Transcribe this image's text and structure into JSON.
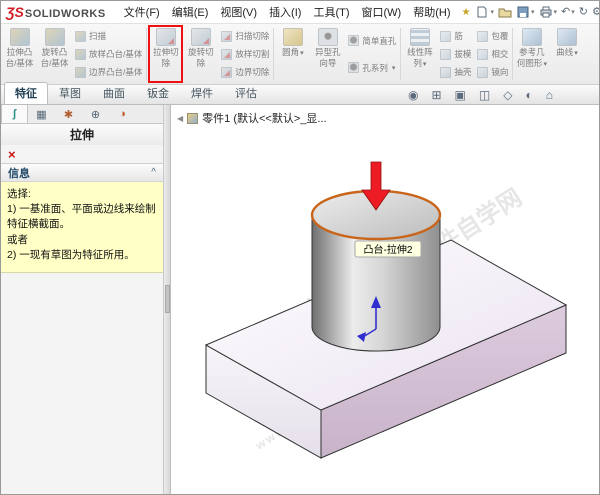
{
  "titlebar": {
    "logo_prefix": "ƷS",
    "logo": "SOLIDWORKS",
    "menus": [
      "文件(F)",
      "编辑(E)",
      "视图(V)",
      "插入(I)",
      "工具(T)",
      "窗口(W)",
      "帮助(H)"
    ]
  },
  "ribbon": {
    "extruded_boss_1": "拉伸凸",
    "extruded_boss_2": "台/基体",
    "revolved_boss_1": "旋转凸",
    "revolved_boss_2": "台/基体",
    "swept_boss": "扫描",
    "lofted_boss": "放样凸台/基体",
    "boundary_boss": "边界凸台/基体",
    "extruded_cut_1": "拉伸切",
    "extruded_cut_2": "除",
    "revolved_cut_1": "旋转切",
    "revolved_cut_2": "除",
    "swept_cut": "扫描切除",
    "lofted_cut": "放样切割",
    "boundary_cut": "边界切除",
    "fillet": "圆角",
    "hole_wizard_1": "异型孔",
    "hole_wizard_2": "向导",
    "simple_hole": "简单直孔",
    "hole_series": "孔系列",
    "linear_pattern_1": "线性阵",
    "linear_pattern_2": "列",
    "rib": "筋",
    "draft": "拔模",
    "shell": "抽壳",
    "wrap": "包覆",
    "intersect": "相交",
    "mirror": "镜向",
    "ref_geo_1": "参考几",
    "ref_geo_2": "何图形",
    "curves": "曲线"
  },
  "tabs": {
    "t0": "特征",
    "t1": "草图",
    "t2": "曲面",
    "t3": "钣金",
    "t4": "焊件",
    "t5": "评估"
  },
  "pm": {
    "title": "拉伸",
    "message_header": "信息",
    "l1": "选择:",
    "l2": "1) 一基准面、平面或边线来绘制特征横截面。",
    "l3": "或者",
    "l4": "2) 一现有草图为特征所用。"
  },
  "tree": {
    "root": "零件1 (默认<<默认>_显..."
  },
  "viewport": {
    "tooltip": "凸台-拉伸2",
    "watermark_main": "软件自学网",
    "watermark_sub": "www.rjzxw.com"
  },
  "icons": {
    "close": "×",
    "chevron_up": "^",
    "dropdown": "▾",
    "collapse": "◀",
    "pin": "★",
    "undo": "↶",
    "rebuild": "↻",
    "gear": "⚙",
    "help": "?",
    "overflow": "▸",
    "pm_tabs": [
      "ʃ",
      "▦",
      "✱",
      "⊕",
      "◑"
    ],
    "headsup": [
      "◉",
      "⊞",
      "▣",
      "◫",
      "◇",
      "◐",
      "⌂"
    ]
  },
  "colors": {
    "highlight_red": "#ee1111",
    "selection_orange": "#c8651b",
    "plate_side": "#d5c3d6",
    "message_yellow": "#ffffc6"
  }
}
